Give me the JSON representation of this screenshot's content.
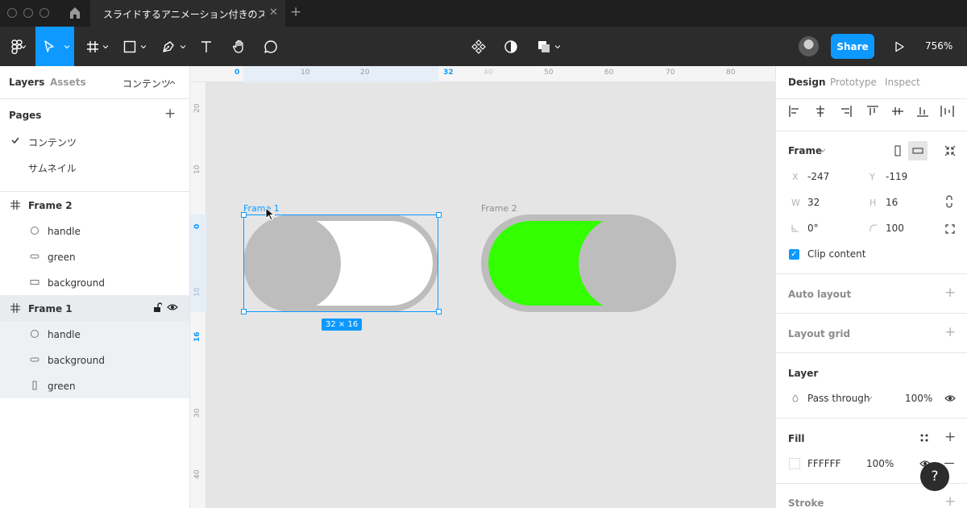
{
  "titlebar": {
    "tab_title": "スライドするアニメーション付きのス...",
    "tab_close": "✕",
    "tab_add": "+"
  },
  "toolbar": {
    "share_label": "Share",
    "zoom": "756%",
    "tools": [
      "main-menu",
      "move",
      "frame",
      "shape",
      "pen",
      "text",
      "hand",
      "comment"
    ],
    "accent_color": "#0d99ff"
  },
  "left_panel": {
    "tabs": {
      "layers": "Layers",
      "assets": "Assets",
      "page_selector": "コンテンツ"
    },
    "pages_title": "Pages",
    "pages": [
      {
        "label": "コンテンツ",
        "current": true
      },
      {
        "label": "サムネイル",
        "current": false
      }
    ],
    "layers": [
      {
        "label": "Frame 2",
        "type": "frame"
      },
      {
        "label": "handle",
        "type": "ellipse"
      },
      {
        "label": "green",
        "type": "rounded-rect"
      },
      {
        "label": "background",
        "type": "rect"
      },
      {
        "label": "Frame 1",
        "type": "frame",
        "selected": true
      },
      {
        "label": "handle",
        "type": "ellipse"
      },
      {
        "label": "background",
        "type": "rounded-rect"
      },
      {
        "label": "green",
        "type": "tall-rect"
      }
    ]
  },
  "canvas": {
    "ruler_top": [
      "0",
      "10",
      "20",
      "32",
      "40",
      "50",
      "60",
      "70",
      "80"
    ],
    "ruler_left": [
      "20",
      "10",
      "0",
      "10",
      "16",
      "30",
      "40"
    ],
    "frame1_label": "Frame 1",
    "frame2_label": "Frame 2",
    "size_badge": "32 × 16",
    "colors": {
      "track": "#bdbdbd",
      "knob": "#bdbdbd",
      "white": "#ffffff",
      "green": "#33ff00"
    }
  },
  "right_panel": {
    "tabs": {
      "design": "Design",
      "prototype": "Prototype",
      "inspect": "Inspect"
    },
    "frame_section": {
      "title": "Frame",
      "x_label": "X",
      "x": "-247",
      "y_label": "Y",
      "y": "-119",
      "w_label": "W",
      "w": "32",
      "h_label": "H",
      "h": "16",
      "rotation": "0°",
      "radius": "100",
      "clip_label": "Clip content",
      "clip_checked": true
    },
    "auto_layout": "Auto layout",
    "layout_grid": "Layout grid",
    "layer": {
      "title": "Layer",
      "blend": "Pass through",
      "opacity": "100%"
    },
    "fill": {
      "title": "Fill",
      "hex": "FFFFFF",
      "opacity": "100%",
      "swatch": "#ffffff"
    },
    "stroke": "Stroke"
  },
  "help": "?"
}
